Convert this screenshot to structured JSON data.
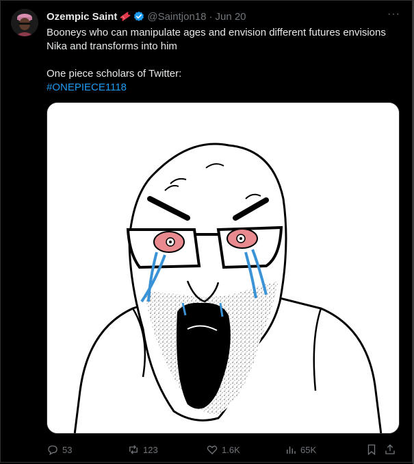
{
  "tweet": {
    "author": {
      "name": "Ozempic Saint",
      "handle": "@Saintjon18",
      "date": "Jun 20"
    },
    "more_label": "···",
    "text_line1": "Booneys who can manipulate ages and envision different futures envisions Nika and transforms into him",
    "text_line2": "One piece scholars of Twitter:",
    "hashtag": "#ONEPIECE1118",
    "media": {
      "description_icon": "crying-wojak-image"
    },
    "actions": {
      "replies": "53",
      "reposts": "123",
      "likes": "1.6K",
      "views": "65K"
    }
  },
  "colors": {
    "background": "#000000",
    "text": "#e7e9ea",
    "muted": "#71767b",
    "accent": "#1d9bf0",
    "tear": "#3a93d6",
    "eye_red": "#e98a8f"
  }
}
